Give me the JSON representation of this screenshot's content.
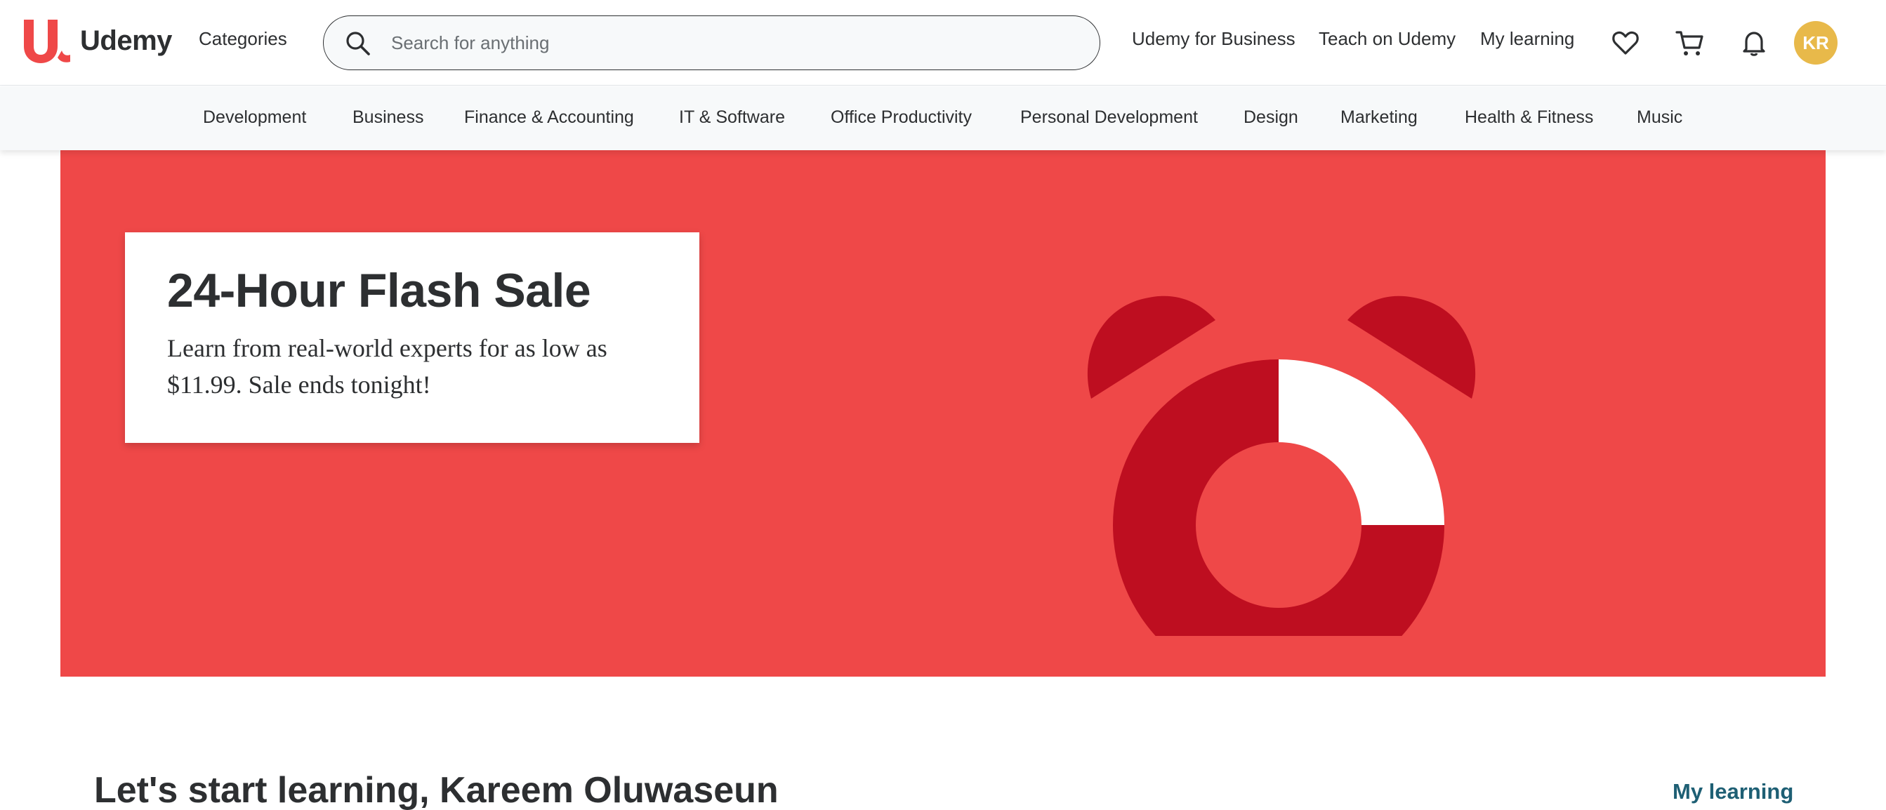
{
  "header": {
    "logo_text": "Udemy",
    "categories_label": "Categories",
    "search": {
      "placeholder": "Search for anything",
      "value": ""
    },
    "links": {
      "business": "Udemy for Business",
      "teach": "Teach on Udemy",
      "my_learning": "My learning"
    },
    "icons": [
      "heart-icon",
      "cart-icon",
      "bell-icon"
    ],
    "avatar_initials": "KR"
  },
  "category_bar": {
    "items": [
      "Development",
      "Business",
      "Finance & Accounting",
      "IT & Software",
      "Office Productivity",
      "Personal Development",
      "Design",
      "Marketing",
      "Health & Fitness",
      "Music"
    ]
  },
  "hero": {
    "title": "24-Hour Flash Sale",
    "text": "Learn from real-world experts for as low as $11.99. Sale ends tonight!",
    "colors": {
      "background": "#ef4848",
      "clock": "#be0e20",
      "highlight": "#ffffff"
    }
  },
  "greeting": {
    "text": "Let's start learning, Kareem Oluwaseun",
    "link": "My learning"
  },
  "colors": {
    "brand": "#a435f0",
    "logo": "#ef4848",
    "avatar": "#e8b94a",
    "link": "#1e5f74"
  }
}
